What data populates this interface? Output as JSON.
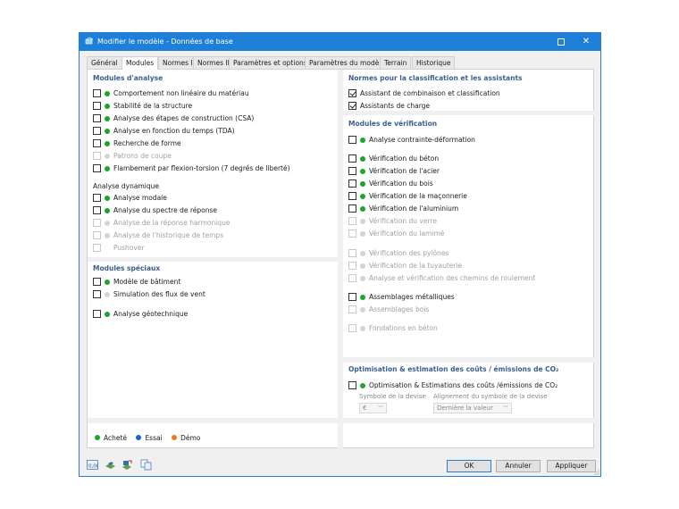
{
  "window": {
    "title": "Modifier le modèle - Données de base",
    "maximize_label": "☐",
    "close_label": "✕"
  },
  "tabs": [
    {
      "label": "Général"
    },
    {
      "label": "Modules"
    },
    {
      "label": "Normes I"
    },
    {
      "label": "Normes II"
    },
    {
      "label": "Paramètres et options"
    },
    {
      "label": "Paramètres du modèle"
    },
    {
      "label": "Terrain"
    },
    {
      "label": "Historique"
    }
  ],
  "analysis": {
    "title": "Modules d'analyse",
    "items": [
      {
        "label": "Comportement non linéaire du matériau",
        "status": "green",
        "enabled": true
      },
      {
        "label": "Stabilité de la structure",
        "status": "green",
        "enabled": true
      },
      {
        "label": "Analyse des étapes de construction (CSA)",
        "status": "green",
        "enabled": true
      },
      {
        "label": "Analyse en fonction du temps (TDA)",
        "status": "green",
        "enabled": true
      },
      {
        "label": "Recherche de forme",
        "status": "green",
        "enabled": true
      },
      {
        "label": "Patrons de coupe",
        "status": "grey",
        "enabled": false
      },
      {
        "label": "Flambement par flexion-torsion (7 degrés de liberté)",
        "status": "green",
        "enabled": true
      }
    ],
    "dynamic_title": "Analyse dynamique",
    "dynamic_items": [
      {
        "label": "Analyse modale",
        "status": "green",
        "enabled": true
      },
      {
        "label": "Analyse du spectre de réponse",
        "status": "green",
        "enabled": true
      },
      {
        "label": "Analyse de la réponse harmonique",
        "status": "grey",
        "enabled": false
      },
      {
        "label": "Analyse de l'historique de temps",
        "status": "grey",
        "enabled": false
      },
      {
        "label": "Pushover",
        "status": "none",
        "enabled": false
      }
    ]
  },
  "special": {
    "title": "Modules spéciaux",
    "items": [
      {
        "label": "Modèle de bâtiment",
        "status": "green",
        "enabled": true
      },
      {
        "label": "Simulation des flux de vent",
        "status": "grey",
        "enabled": true
      },
      {
        "label": "Analyse géotechnique",
        "status": "green",
        "enabled": true
      }
    ]
  },
  "legend": {
    "items": [
      {
        "label": "Acheté",
        "color": "#1fa32a"
      },
      {
        "label": "Essai",
        "color": "#1565d8"
      },
      {
        "label": "Démo",
        "color": "#f07a1a"
      }
    ]
  },
  "norms": {
    "title": "Normes pour la classification et les assistants",
    "items": [
      {
        "label": "Assistant de combinaison et classification",
        "checked": true
      },
      {
        "label": "Assistants de charge",
        "checked": true
      }
    ]
  },
  "design": {
    "title": "Modules de vérification",
    "items": [
      {
        "label": "Analyse contrainte-déformation",
        "status": "green",
        "enabled": true
      },
      {
        "label": "Vérification du béton",
        "status": "green",
        "enabled": true
      },
      {
        "label": "Vérification de l'acier",
        "status": "green",
        "enabled": true
      },
      {
        "label": "Vérification du bois",
        "status": "green",
        "enabled": true
      },
      {
        "label": "Vérification de la maçonnerie",
        "status": "green",
        "enabled": true
      },
      {
        "label": "Vérification de l'aluminium",
        "status": "green",
        "enabled": true
      },
      {
        "label": "Vérification du verre",
        "status": "grey",
        "enabled": false
      },
      {
        "label": "Vérification du lamimé",
        "status": "grey",
        "enabled": false
      },
      {
        "label": "Vérification des pylônes",
        "status": "grey",
        "enabled": false
      },
      {
        "label": "Vérification de la tuyauterie",
        "status": "grey",
        "enabled": false
      },
      {
        "label": "Analyse et vérification des chemins de roulement",
        "status": "grey",
        "enabled": false
      },
      {
        "label": "Assemblages métalliques",
        "status": "green",
        "enabled": true
      },
      {
        "label": "Assemblages bois",
        "status": "grey",
        "enabled": false
      },
      {
        "label": "Fondations en béton",
        "status": "grey",
        "enabled": false
      }
    ]
  },
  "optimization": {
    "title": "Optimisation & estimation des coûts / émissions de CO₂",
    "item": {
      "label": "Optimisation & Estimations des coûts /émissions de CO₂",
      "status": "green"
    },
    "currency_label": "Symbole de la devise",
    "currency_value": "€",
    "alignment_label": "Alignement du symbole de la devise",
    "alignment_value": "Dernière la valeur"
  },
  "buttons": {
    "ok": "OK",
    "cancel": "Annuler",
    "apply": "Appliquer"
  },
  "colors": {
    "titlebar": "#1e7fd8",
    "section_title": "#3a5f8f",
    "green": "#1fa32a"
  }
}
